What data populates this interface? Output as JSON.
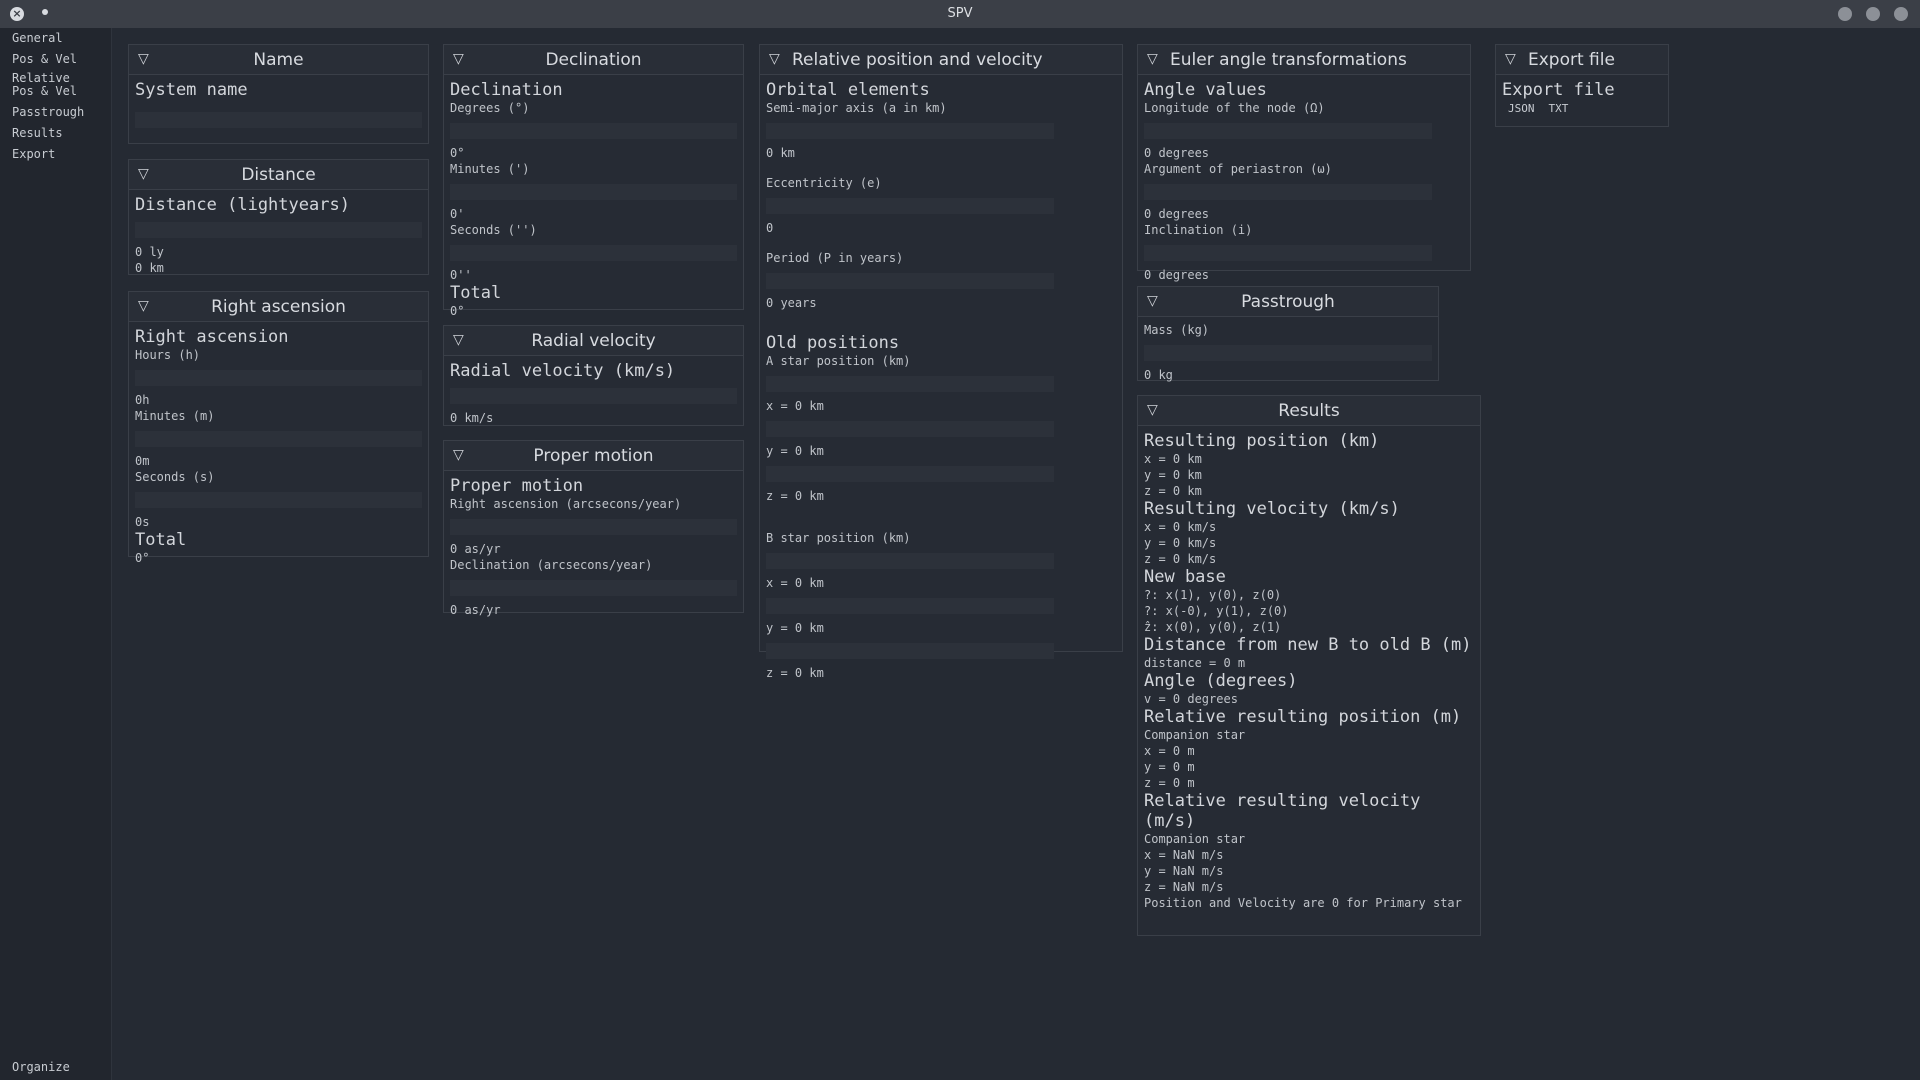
{
  "window": {
    "title": "SPV"
  },
  "sidebar": {
    "items": [
      "General",
      "Pos & Vel",
      "Relative\nPos & Vel",
      "Passtrough",
      "Results",
      "Export"
    ],
    "bottom": "Organize"
  },
  "name_panel": {
    "header": "Name",
    "title": "System name"
  },
  "distance_panel": {
    "header": "Distance",
    "title": "Distance (lightyears)",
    "value_ly": "0 ly",
    "value_km": "0 km"
  },
  "ra_panel": {
    "header": "Right ascension",
    "title": "Right ascension",
    "hours_label": "Hours (h)",
    "hours_value": "0h",
    "minutes_label": "Minutes (m)",
    "minutes_value": "0m",
    "seconds_label": "Seconds (s)",
    "seconds_value": "0s",
    "total_title": "Total",
    "total_value": "0°"
  },
  "dec_panel": {
    "header": "Declination",
    "title": "Declination",
    "degrees_label": "Degrees (°)",
    "degrees_value": "0°",
    "minutes_label": "Minutes (')",
    "minutes_value": "0'",
    "seconds_label": "Seconds ('')",
    "seconds_value": "0''",
    "total_title": "Total",
    "total_value": "0°"
  },
  "radial_panel": {
    "header": "Radial velocity",
    "title": "Radial velocity (km/s)",
    "value": "0 km/s"
  },
  "proper_panel": {
    "header": "Proper motion",
    "title": "Proper motion",
    "ra_label": "Right ascension (arcsecons/year)",
    "ra_value": "0 as/yr",
    "dec_label": "Declination (arcsecons/year)",
    "dec_value": "0 as/yr"
  },
  "relpos_panel": {
    "header": "Relative position and velocity",
    "orbital_title": "Orbital elements",
    "a_label": "Semi-major axis (a in km)",
    "a_value": "0 km",
    "e_label": "Eccentricity (e)",
    "e_value": "0",
    "p_label": "Period (P in years)",
    "p_value": "0 years",
    "old_title": "Old positions",
    "a_star_label": "A star position (km)",
    "a_x": "x = 0 km",
    "a_y": "y = 0 km",
    "a_z": "z = 0 km",
    "b_star_label": "B star position (km)",
    "b_x": "x = 0 km",
    "b_y": "y = 0 km",
    "b_z": "z = 0 km"
  },
  "euler_panel": {
    "header": "Euler angle transformations",
    "title": "Angle values",
    "node_label": "Longitude of the node (Ω)",
    "node_value": "0 degrees",
    "peri_label": "Argument of periastron (ω)",
    "peri_value": "0 degrees",
    "incl_label": "Inclination (i)",
    "incl_value": "0 degrees"
  },
  "passtrough_panel": {
    "header": "Passtrough",
    "mass_label": "Mass (kg)",
    "mass_value": "0 kg"
  },
  "results_panel": {
    "header": "Results",
    "pos_title": "Resulting position (km)",
    "pos": [
      "x = 0 km",
      "y = 0 km",
      "z = 0 km"
    ],
    "vel_title": "Resulting velocity (km/s)",
    "vel": [
      "x = 0 km/s",
      "y = 0 km/s",
      "z = 0 km/s"
    ],
    "base_title": "New base",
    "base": [
      "?: x(1), y(0), z(0)",
      "?: x(-0), y(1), z(0)",
      "ẑ: x(0), y(0), z(1)"
    ],
    "dist_title": "Distance from new B to old B (m)",
    "dist": "distance = 0 m",
    "angle_title": "Angle (degrees)",
    "angle": "v = 0 degrees",
    "relpos_title": "Relative resulting position (m)",
    "relpos_sub": "Companion star",
    "relpos": [
      "x = 0 m",
      "y = 0 m",
      "z = 0 m"
    ],
    "relvel_title": "Relative resulting velocity (m/s)",
    "relvel_sub": "Companion star",
    "relvel": [
      "x = NaN m/s",
      "y = NaN m/s",
      "z = NaN m/s"
    ],
    "note": "Position and Velocity are 0 for Primary star"
  },
  "export_panel": {
    "header": "Export file",
    "title": "Export file",
    "json_btn": "JSON",
    "txt_btn": "TXT"
  },
  "icons": {
    "collapse": "triangle-down-icon",
    "close": "close-icon"
  }
}
